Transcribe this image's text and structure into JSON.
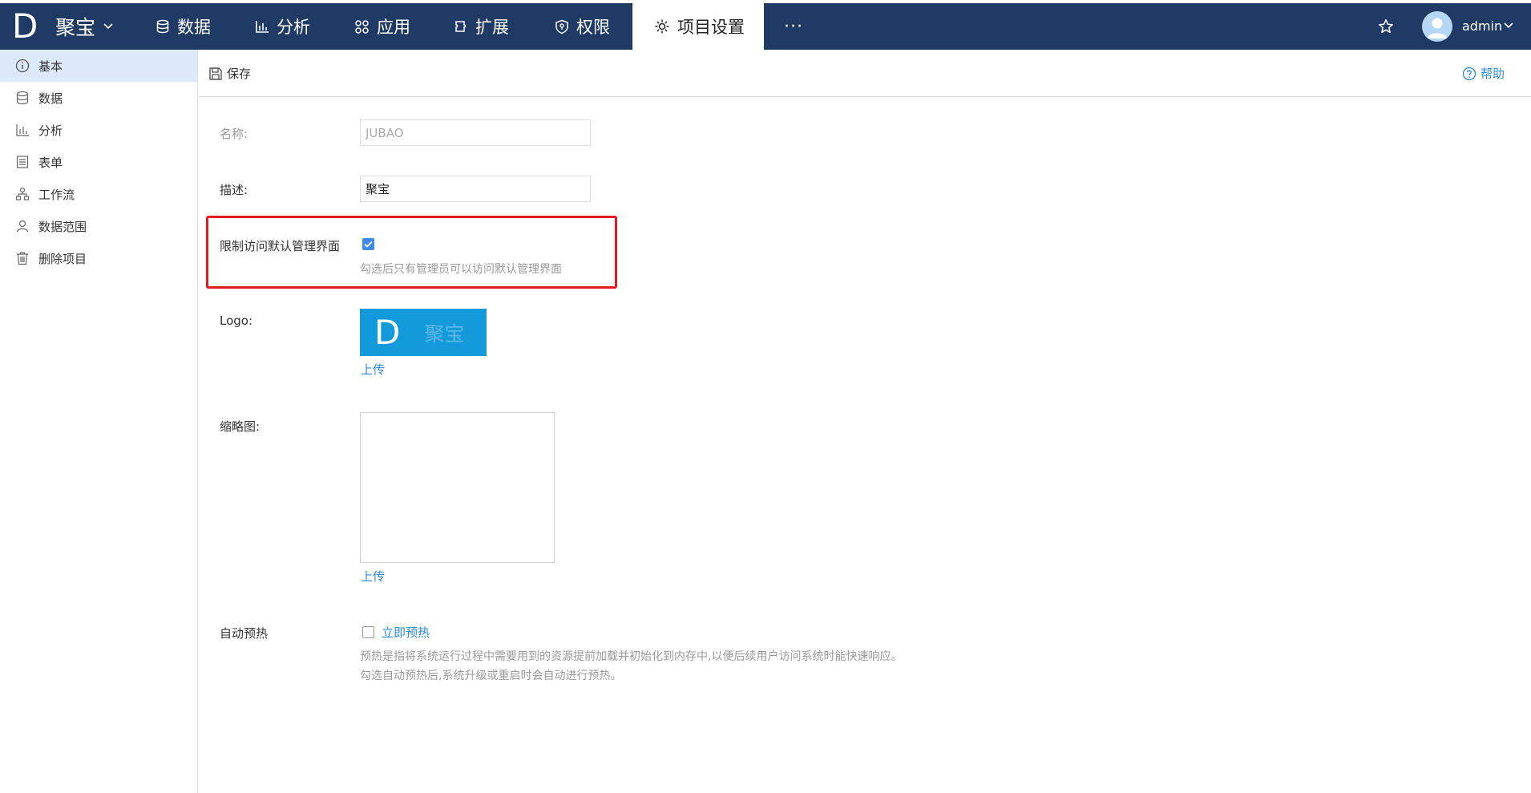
{
  "brand": {
    "logo_letter": "D",
    "name": "聚宝"
  },
  "nav": {
    "items": [
      {
        "label": "数据",
        "icon": "database-icon"
      },
      {
        "label": "分析",
        "icon": "bar-chart-icon"
      },
      {
        "label": "应用",
        "icon": "apps-icon"
      },
      {
        "label": "扩展",
        "icon": "puzzle-icon"
      },
      {
        "label": "权限",
        "icon": "shield-icon"
      },
      {
        "label": "项目设置",
        "icon": "gear-icon",
        "active": true
      }
    ],
    "more": "···"
  },
  "user": {
    "name": "admin"
  },
  "sidebar": {
    "items": [
      {
        "label": "基本",
        "icon": "info-icon",
        "active": true
      },
      {
        "label": "数据",
        "icon": "database-icon"
      },
      {
        "label": "分析",
        "icon": "bar-chart-icon"
      },
      {
        "label": "表单",
        "icon": "form-icon"
      },
      {
        "label": "工作流",
        "icon": "workflow-icon"
      },
      {
        "label": "数据范围",
        "icon": "user-scope-icon"
      },
      {
        "label": "删除项目",
        "icon": "trash-icon"
      }
    ]
  },
  "toolbar": {
    "save_label": "保存",
    "help_label": "帮助"
  },
  "form": {
    "name_label": "名称:",
    "name_value": "JUBAO",
    "desc_label": "描述:",
    "desc_value": "聚宝",
    "restrict_label": "限制访问默认管理界面",
    "restrict_checked": true,
    "restrict_hint": "勾选后只有管理员可以访问默认管理界面",
    "logo_label": "Logo:",
    "logo_letter": "D",
    "logo_text": "聚宝",
    "logo_upload": "上传",
    "thumb_label": "缩略图:",
    "thumb_upload": "上传",
    "preheat_label": "自动预热",
    "preheat_checked": false,
    "preheat_now": "立即预热",
    "preheat_hint_1": "预热是指将系统运行过程中需要用到的资源提前加载并初始化到内存中,以便后续用户访问系统时能快速响应。",
    "preheat_hint_2": "勾选自动预热后,系统升级或重启时会自动进行预热。"
  },
  "colors": {
    "nav_bg": "#203a66",
    "accent": "#2a8ae0",
    "highlight": "#e6191e",
    "logo_bg": "#129adb"
  }
}
